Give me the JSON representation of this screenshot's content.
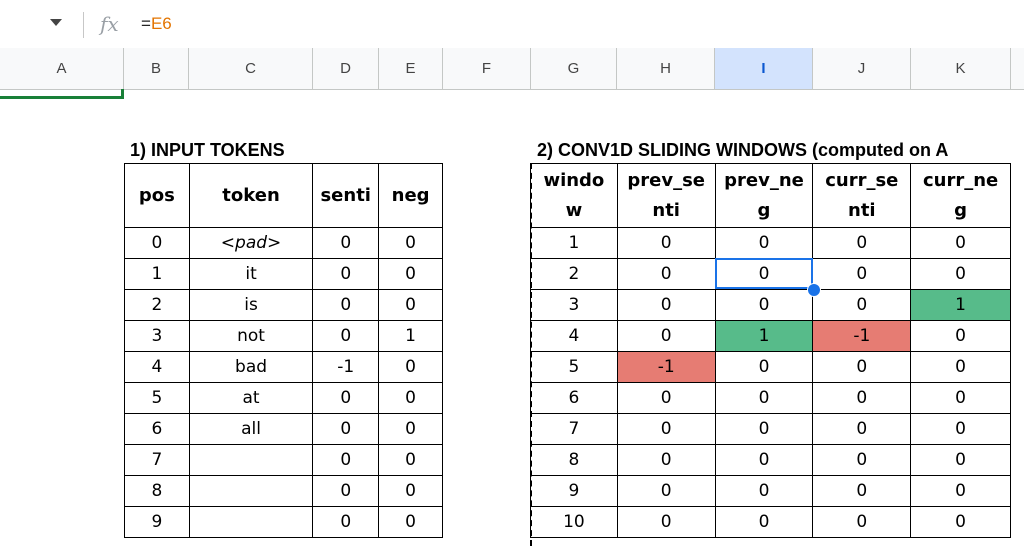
{
  "formula": {
    "eq": "=",
    "ref": "E6",
    "fx_icon": "fx-icon"
  },
  "columns": [
    "A",
    "B",
    "C",
    "D",
    "E",
    "F",
    "G",
    "H",
    "I",
    "J",
    "K"
  ],
  "table1": {
    "title": "1) INPUT TOKENS",
    "headers": [
      "pos",
      "token",
      "senti",
      "neg"
    ],
    "rows": [
      [
        "0",
        "<pad>",
        "0",
        "0"
      ],
      [
        "1",
        "it",
        "0",
        "0"
      ],
      [
        "2",
        "is",
        "0",
        "0"
      ],
      [
        "3",
        "not",
        "0",
        "1"
      ],
      [
        "4",
        "bad",
        "-1",
        "0"
      ],
      [
        "5",
        "at",
        "0",
        "0"
      ],
      [
        "6",
        "all",
        "0",
        "0"
      ],
      [
        "7",
        "",
        "0",
        "0"
      ],
      [
        "8",
        "",
        "0",
        "0"
      ],
      [
        "9",
        "",
        "0",
        "0"
      ]
    ]
  },
  "table2": {
    "title": "2) CONV1D SLIDING WINDOWS (computed on A",
    "headers": [
      [
        "windo",
        "w"
      ],
      [
        "prev_se",
        "nti"
      ],
      [
        "prev_ne",
        "g"
      ],
      [
        "curr_se",
        "nti"
      ],
      [
        "curr_ne",
        "g"
      ]
    ],
    "rows": [
      [
        "1",
        "0",
        "0",
        "0",
        "0"
      ],
      [
        "2",
        "0",
        "0",
        "0",
        "0"
      ],
      [
        "3",
        "0",
        "0",
        "0",
        "1"
      ],
      [
        "4",
        "0",
        "1",
        "-1",
        "0"
      ],
      [
        "5",
        "-1",
        "0",
        "0",
        "0"
      ],
      [
        "6",
        "0",
        "0",
        "0",
        "0"
      ],
      [
        "7",
        "0",
        "0",
        "0",
        "0"
      ],
      [
        "8",
        "0",
        "0",
        "0",
        "0"
      ],
      [
        "9",
        "0",
        "0",
        "0",
        "0"
      ],
      [
        "10",
        "0",
        "0",
        "0",
        "0"
      ]
    ],
    "highlights": {
      "green": "#57bb8a",
      "red": "#e67c73"
    }
  }
}
